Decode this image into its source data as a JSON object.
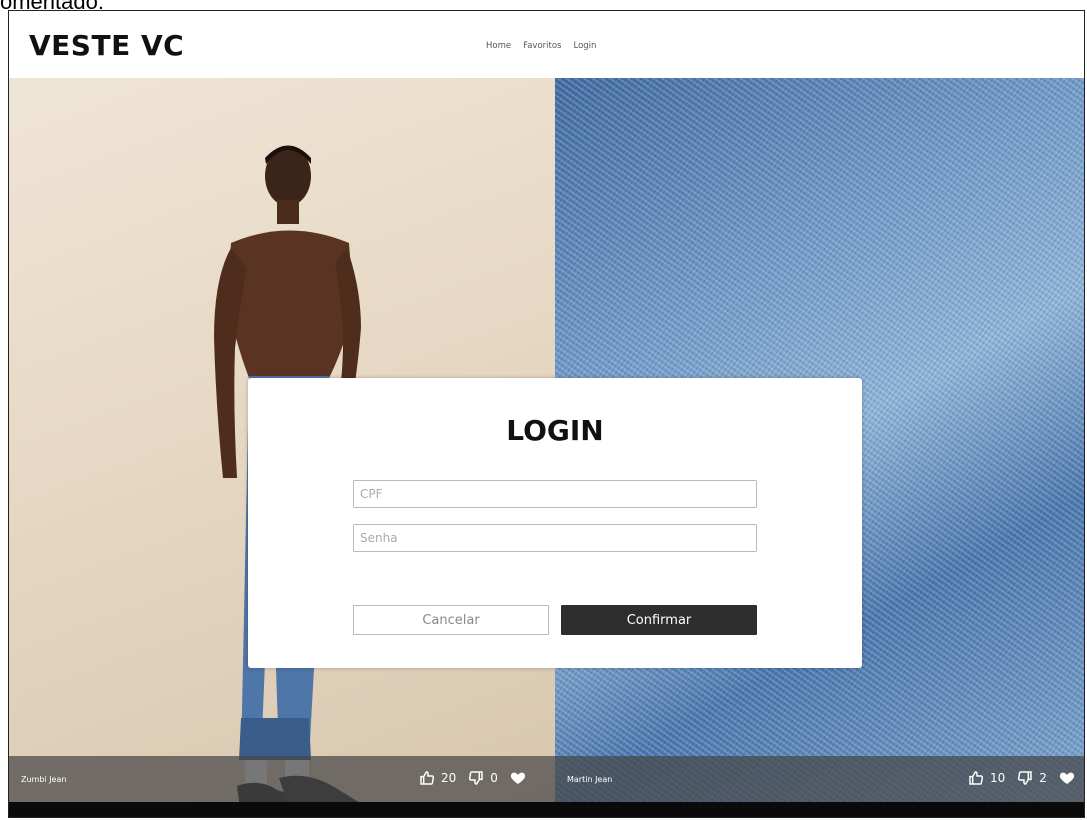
{
  "caption_fragment": "omentado:",
  "header": {
    "brand": "VESTE VC",
    "nav": [
      "Home",
      "Favoritos",
      "Login"
    ]
  },
  "products": [
    {
      "name": "Zumbi Jean",
      "likes": "20",
      "dislikes": "0"
    },
    {
      "name": "Martin Jean",
      "likes": "10",
      "dislikes": "2"
    }
  ],
  "login": {
    "title": "LOGIN",
    "cpf_placeholder": "CPF",
    "password_placeholder": "Senha",
    "cancel_label": "Cancelar",
    "confirm_label": "Confirmar"
  },
  "icons": {
    "like": "thumbs-up-icon",
    "dislike": "thumbs-down-icon",
    "favorite": "heart-icon"
  },
  "colors": {
    "confirm_button": "#2d2d2d",
    "caption_bar": "#464646"
  }
}
